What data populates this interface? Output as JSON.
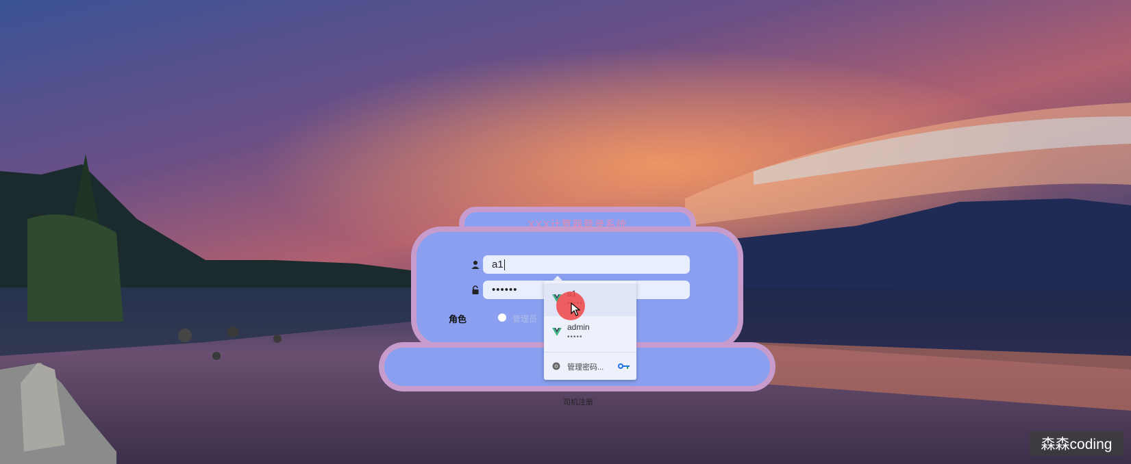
{
  "header": {
    "title": "XXX计算器登录系统"
  },
  "form": {
    "username_value": "a1",
    "password_mask": "••••••",
    "role_label": "角色",
    "role_options": [
      "管理员"
    ]
  },
  "autofill": {
    "accounts": [
      {
        "username": "a1",
        "password_mask": "•••••"
      },
      {
        "username": "admin",
        "password_mask": "•••••"
      }
    ],
    "manage_label": "管理密码..."
  },
  "links": {
    "driver_register": "司机注册"
  },
  "watermark": "森森coding",
  "colors": {
    "card_fill": "#8a9ff0",
    "card_border": "#c79ccd",
    "title_text": "#e58cb3",
    "input_bg": "#e8eefc",
    "click_indicator": "#f04646"
  },
  "icons": [
    "user-icon",
    "lock-icon",
    "vue-logo-icon",
    "chrome-icon",
    "key-icon",
    "mouse-cursor-icon"
  ]
}
